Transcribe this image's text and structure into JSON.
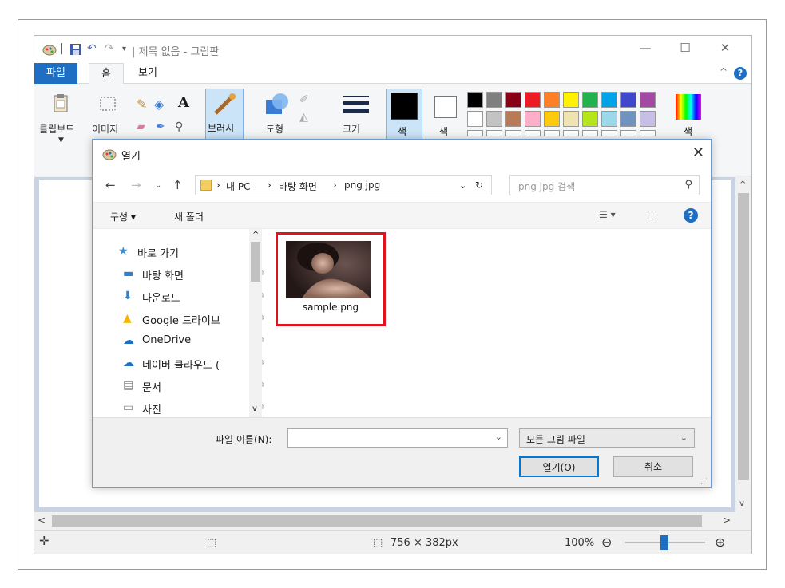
{
  "app": {
    "title": "| 제목 없음 - 그림판",
    "quick_access": [
      "save-icon",
      "undo-icon",
      "redo-icon",
      "customize-icon"
    ]
  },
  "ribbon": {
    "tabs": [
      "파일",
      "홈",
      "보기"
    ],
    "groups": {
      "clipboard": "클립보드",
      "image": "이미지",
      "brush": "브러시",
      "shapes": "도형",
      "size": "크기",
      "color1": "색",
      "color2": "색",
      "edit_colors": "색"
    },
    "palette_row1": [
      "#000000",
      "#7f7f7f",
      "#880015",
      "#ed1c24",
      "#ff7f27",
      "#fff200",
      "#22b14c",
      "#00a2e8",
      "#3f48cc",
      "#a349a4"
    ],
    "palette_row2": [
      "#ffffff",
      "#c3c3c3",
      "#b97a57",
      "#ffaec9",
      "#ffc90e",
      "#efe4b0",
      "#b5e61d",
      "#99d9ea",
      "#7092be",
      "#c8bfe7"
    ]
  },
  "dialog": {
    "title": "열기",
    "breadcrumb": [
      "내 PC",
      "바탕 화면",
      "png jpg"
    ],
    "search_placeholder": "png jpg 검색",
    "organize": "구성 ▾",
    "new_folder": "새 폴더",
    "nav_items": [
      {
        "label": "바로 가기",
        "icon": "star-icon",
        "color": "#3b8fd8"
      },
      {
        "label": "바탕 화면",
        "icon": "desktop-icon",
        "color": "#2e7fd1"
      },
      {
        "label": "다운로드",
        "icon": "download-icon",
        "color": "#2e7fd1"
      },
      {
        "label": "Google 드라이브",
        "icon": "google-drive-icon",
        "color": "#f4b400"
      },
      {
        "label": "OneDrive",
        "icon": "onedrive-icon",
        "color": "#1e6ec3"
      },
      {
        "label": "네이버 클라우드 (",
        "icon": "naver-cloud-icon",
        "color": "#1e6ec3"
      },
      {
        "label": "문서",
        "icon": "document-icon",
        "color": "#888888"
      },
      {
        "label": "사진",
        "icon": "pictures-icon",
        "color": "#888888"
      }
    ],
    "files": [
      {
        "name": "sample.png",
        "highlighted": true
      }
    ],
    "filename_label": "파일 이름(N):",
    "filename_value": "",
    "filter_value": "모든 그림 파일",
    "open_button": "열기(O)",
    "cancel_button": "취소"
  },
  "status": {
    "image_size": "756 × 382px",
    "zoom": "100%"
  }
}
